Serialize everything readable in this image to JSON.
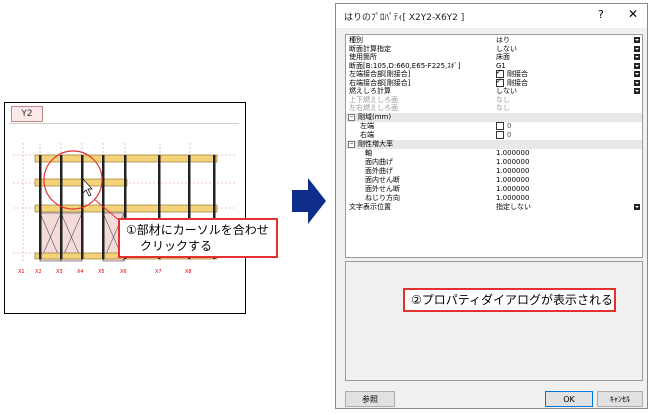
{
  "drawing": {
    "tab_label": "Y2",
    "grid_labels": [
      "X1",
      "X2",
      "X3",
      "X4",
      "X5",
      "X6",
      "X7",
      "X8"
    ]
  },
  "callout1": {
    "line1": "①部材にカーソルを合わせ",
    "line2": "クリックする"
  },
  "dialog": {
    "title": "はりのﾌﾟﾛﾊﾟﾃｨ[ X2Y2-X6Y2 ]",
    "help_label": "?",
    "close_label": "✕",
    "rows": [
      {
        "name": "種別",
        "value": "はり",
        "dropdown": true
      },
      {
        "name": "断面計算指定",
        "value": "しない",
        "dropdown": true
      },
      {
        "name": "使用箇所",
        "value": "床面",
        "dropdown": true
      },
      {
        "name": "断面[B:105,D:660,E65-F225,ｽｷﾞ]",
        "value": "G1",
        "dropdown": true
      },
      {
        "name": "左端接合部[剛接合]",
        "value": "剛接合",
        "dropdown": true,
        "check": true
      },
      {
        "name": "右端接合部[剛接合]",
        "value": "剛接合",
        "dropdown": true,
        "check": true
      },
      {
        "name": "燃えしろ計算",
        "value": "しない",
        "dropdown": true
      },
      {
        "name": "上下燃えしろ面",
        "value": "なし",
        "disabled": true
      },
      {
        "name": "左右燃えしろ面",
        "value": "なし",
        "disabled": true
      }
    ],
    "cat_rigid": "剛域(mm)",
    "rigid_left": "左端",
    "rigid_left_val": "0",
    "rigid_right": "右端",
    "rigid_right_val": "0",
    "cat_factor": "剛性増大率",
    "factor_axis": "軸",
    "factor_rows": [
      {
        "name": "面内曲げ",
        "value": "1.000000"
      },
      {
        "name": "面外曲げ",
        "value": "1.000000"
      },
      {
        "name": "面内せん断",
        "value": "1.000000"
      },
      {
        "name": "面外せん断",
        "value": "1.000000"
      },
      {
        "name": "ねじり方向",
        "value": "1.000000"
      }
    ],
    "axis_value": "1.000000",
    "text_pos_name": "文字表示位置",
    "text_pos_value": "指定しない",
    "callout2": "②プロパティダイアログが表示される",
    "btn_ref": "参照",
    "btn_ok": "OK",
    "btn_cancel": "ｷｬﾝｾﾙ"
  }
}
